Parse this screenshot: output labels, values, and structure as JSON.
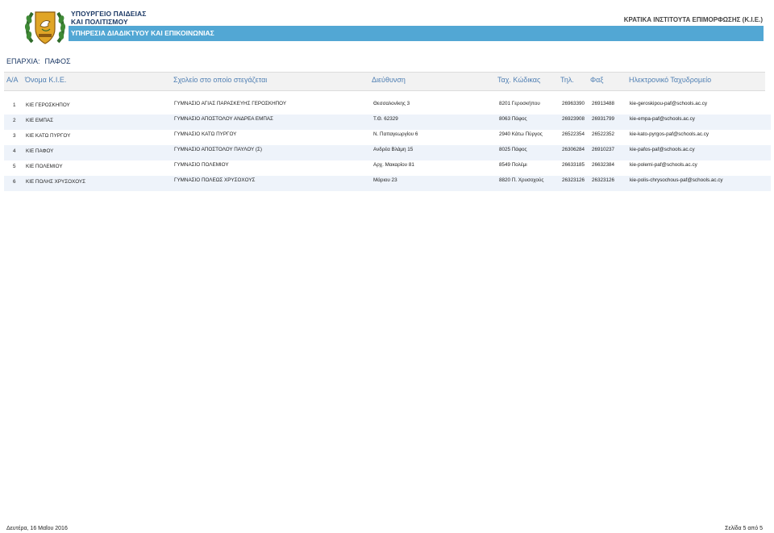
{
  "header": {
    "ministry_line1": "ΥΠΟΥΡΓΕΙΟ ΠΑΙΔΕΙΑΣ",
    "ministry_line2": "ΚΑΙ ΠΟΛΙΤΙΣΜΟΥ",
    "service": "ΥΠΗΡΕΣΙΑ ΔΙΑΔΙΚΤΥΟΥ ΚΑΙ ΕΠΙΚΟΙΝΩΝΙΑΣ",
    "institutes": "ΚΡΑΤΙΚΑ ΙΝΣΤΙΤΟΥΤΑ ΕΠΙΜΟΡΦΩΣΗΣ (Κ.Ι.Ε.)",
    "logo_icon": "cyprus-coat-of-arms-icon",
    "accent_color": "#52a7d4"
  },
  "district": {
    "label": "ΕΠΑΡΧΙΑ:",
    "value": "ΠΑΦΟΣ"
  },
  "table": {
    "headers": {
      "num": "Α/Α",
      "name": "Όνομα Κ.Ι.Ε.",
      "school": "Σχολείο στο οποίο στεγάζεται",
      "address": "Διεύθυνση",
      "postal": "Ταχ. Κώδικας",
      "phone": "Τηλ.",
      "fax": "Φαξ",
      "email": "Ηλεκτρονικό Ταχυδρομείο"
    },
    "rows": [
      {
        "num": "1",
        "name": "ΚΙΕ ΓΕΡΟΣΚΗΠΟΥ",
        "school": "ΓΥΜΝΑΣΙΟ ΑΓΙΑΣ ΠΑΡΑΣΚΕΥΗΣ ΓΕΡΟΣΚΗΠΟΥ",
        "address": "Θεσσαλονίκης 3",
        "postal": "8201 Γεροσκήπου",
        "phone": "26963390",
        "fax": "26913488",
        "email": "kie-geroskipou-paf@schools.ac.cy"
      },
      {
        "num": "2",
        "name": "ΚΙΕ ΕΜΠΑΣ",
        "school": "ΓΥΜΝΑΣΙΟ ΑΠΟΣΤΟΛΟΥ ΑΝΔΡΕΑ ΕΜΠΑΣ",
        "address": "Τ.Θ. 62329",
        "postal": "8063 Πάφος",
        "phone": "26923908",
        "fax": "26931799",
        "email": "kie-empa-paf@schools.ac.cy"
      },
      {
        "num": "3",
        "name": "ΚΙΕ ΚΑΤΩ ΠΥΡΓΟΥ",
        "school": "ΓΥΜΝΑΣΙΟ ΚΑΤΩ ΠΥΡΓΟΥ",
        "address": "Ν. Παπαγεωργίου 6",
        "postal": "2940 Κάτω Πύργος",
        "phone": "26522354",
        "fax": "26522352",
        "email": "kie-kato-pyrgos-paf@schools.ac.cy"
      },
      {
        "num": "4",
        "name": "ΚΙΕ ΠΑΦΟΥ",
        "school": "ΓΥΜΝΑΣΙΟ ΑΠΟΣΤΟΛΟΥ ΠΑΥΛΟΥ (Σ)",
        "address": "Ανδρέα Βλάμη 15",
        "postal": "8025 Πάφος",
        "phone": "26306284",
        "fax": "26910237",
        "email": "kie-pafos-paf@schools.ac.cy"
      },
      {
        "num": "5",
        "name": "ΚΙΕ ΠΟΛΕΜΙΟΥ",
        "school": "ΓΥΜΝΑΣΙΟ ΠΟΛΕΜΙΟΥ",
        "address": "Αρχ. Μακαρίου 81",
        "postal": "8549 Πολέμι",
        "phone": "26633185",
        "fax": "26632384",
        "email": "kie-polemi-paf@schools.ac.cy"
      },
      {
        "num": "6",
        "name": "ΚΙΕ ΠΟΛΗΣ ΧΡΥΣΟΧΟΥΣ",
        "school": "ΓΥΜΝΑΣΙΟ ΠΟΛΕΩΣ ΧΡΥΣΟΧΟΥΣ",
        "address": "Μάριου 23",
        "postal": "8820 Π. Χρυσοχούς",
        "phone": "26323126",
        "fax": "26323126",
        "email": "kie-polis-chrysochous-paf@schools.ac.cy"
      }
    ]
  },
  "footer": {
    "date": "Δευτέρα, 16 Μαΐου 2016",
    "page": "Σελίδα 5 από 5"
  }
}
